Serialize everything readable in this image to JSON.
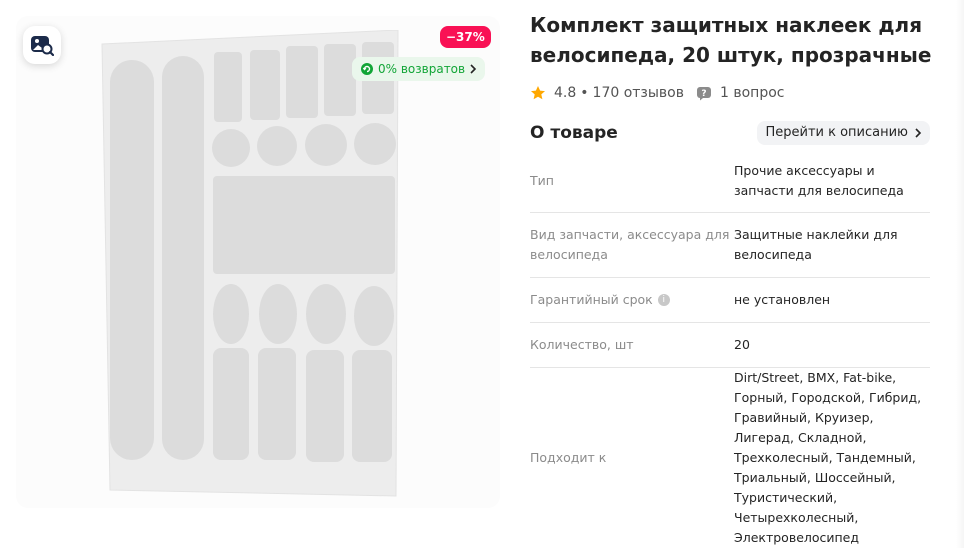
{
  "gallery": {
    "search_photo_icon": "image-search-icon",
    "discount_badge": "−37%",
    "returns_badge": "0% возвратов"
  },
  "product": {
    "title": "Комплект защитных наклеек для велосипеда, 20 штук, прозрачные",
    "rating": "4.8",
    "separator": "•",
    "reviews": "170 отзывов",
    "questions": "1 вопрос"
  },
  "about": {
    "title": "О товаре",
    "to_description": "Перейти к описанию"
  },
  "specs": [
    {
      "name": "Тип",
      "value": "Прочие аксессуары и запчасти для велосипеда"
    },
    {
      "name": "Вид запчасти, аксессуара для велосипеда",
      "value": "Защитные наклейки для велосипеда"
    },
    {
      "name": "Гарантийный срок",
      "value": "не установлен"
    },
    {
      "name": "Количество, шт",
      "value": "20"
    },
    {
      "name": "Подходит к",
      "value": "Dirt/Street, BMX, Fat-bike, Горный, Городской, Гибрид, Гравийный, Круизер, Лигерад, Складной, Трехколесный, Тандемный, Триальный, Шоссейный, Туристический, Четырехколесный, Электровелосипед"
    }
  ],
  "colors": {
    "discount": "#f91155",
    "returns_text": "#12a537",
    "returns_bg": "#eaf7ec",
    "star": "#ffa801"
  }
}
